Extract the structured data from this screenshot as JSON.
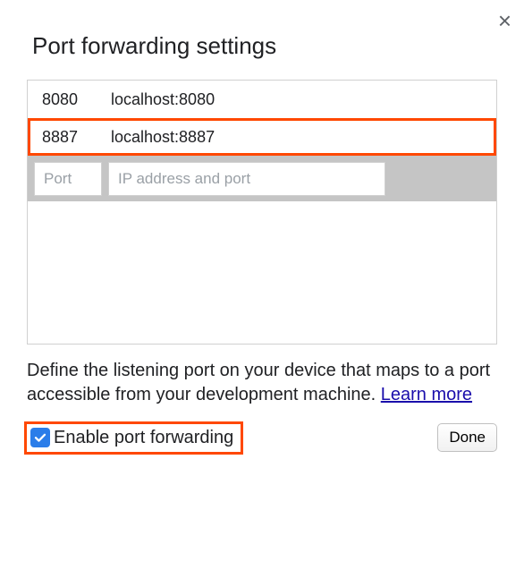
{
  "title": "Port forwarding settings",
  "close_label": "×",
  "rows": [
    {
      "port": "8080",
      "address": "localhost:8080",
      "highlighted": false
    },
    {
      "port": "8887",
      "address": "localhost:8887",
      "highlighted": true
    }
  ],
  "inputs": {
    "port_placeholder": "Port",
    "address_placeholder": "IP address and port"
  },
  "description": {
    "text": "Define the listening port on your device that maps to a port accessible from your development machine. ",
    "link_label": "Learn more"
  },
  "enable": {
    "label": "Enable port forwarding",
    "checked": true
  },
  "done_label": "Done"
}
